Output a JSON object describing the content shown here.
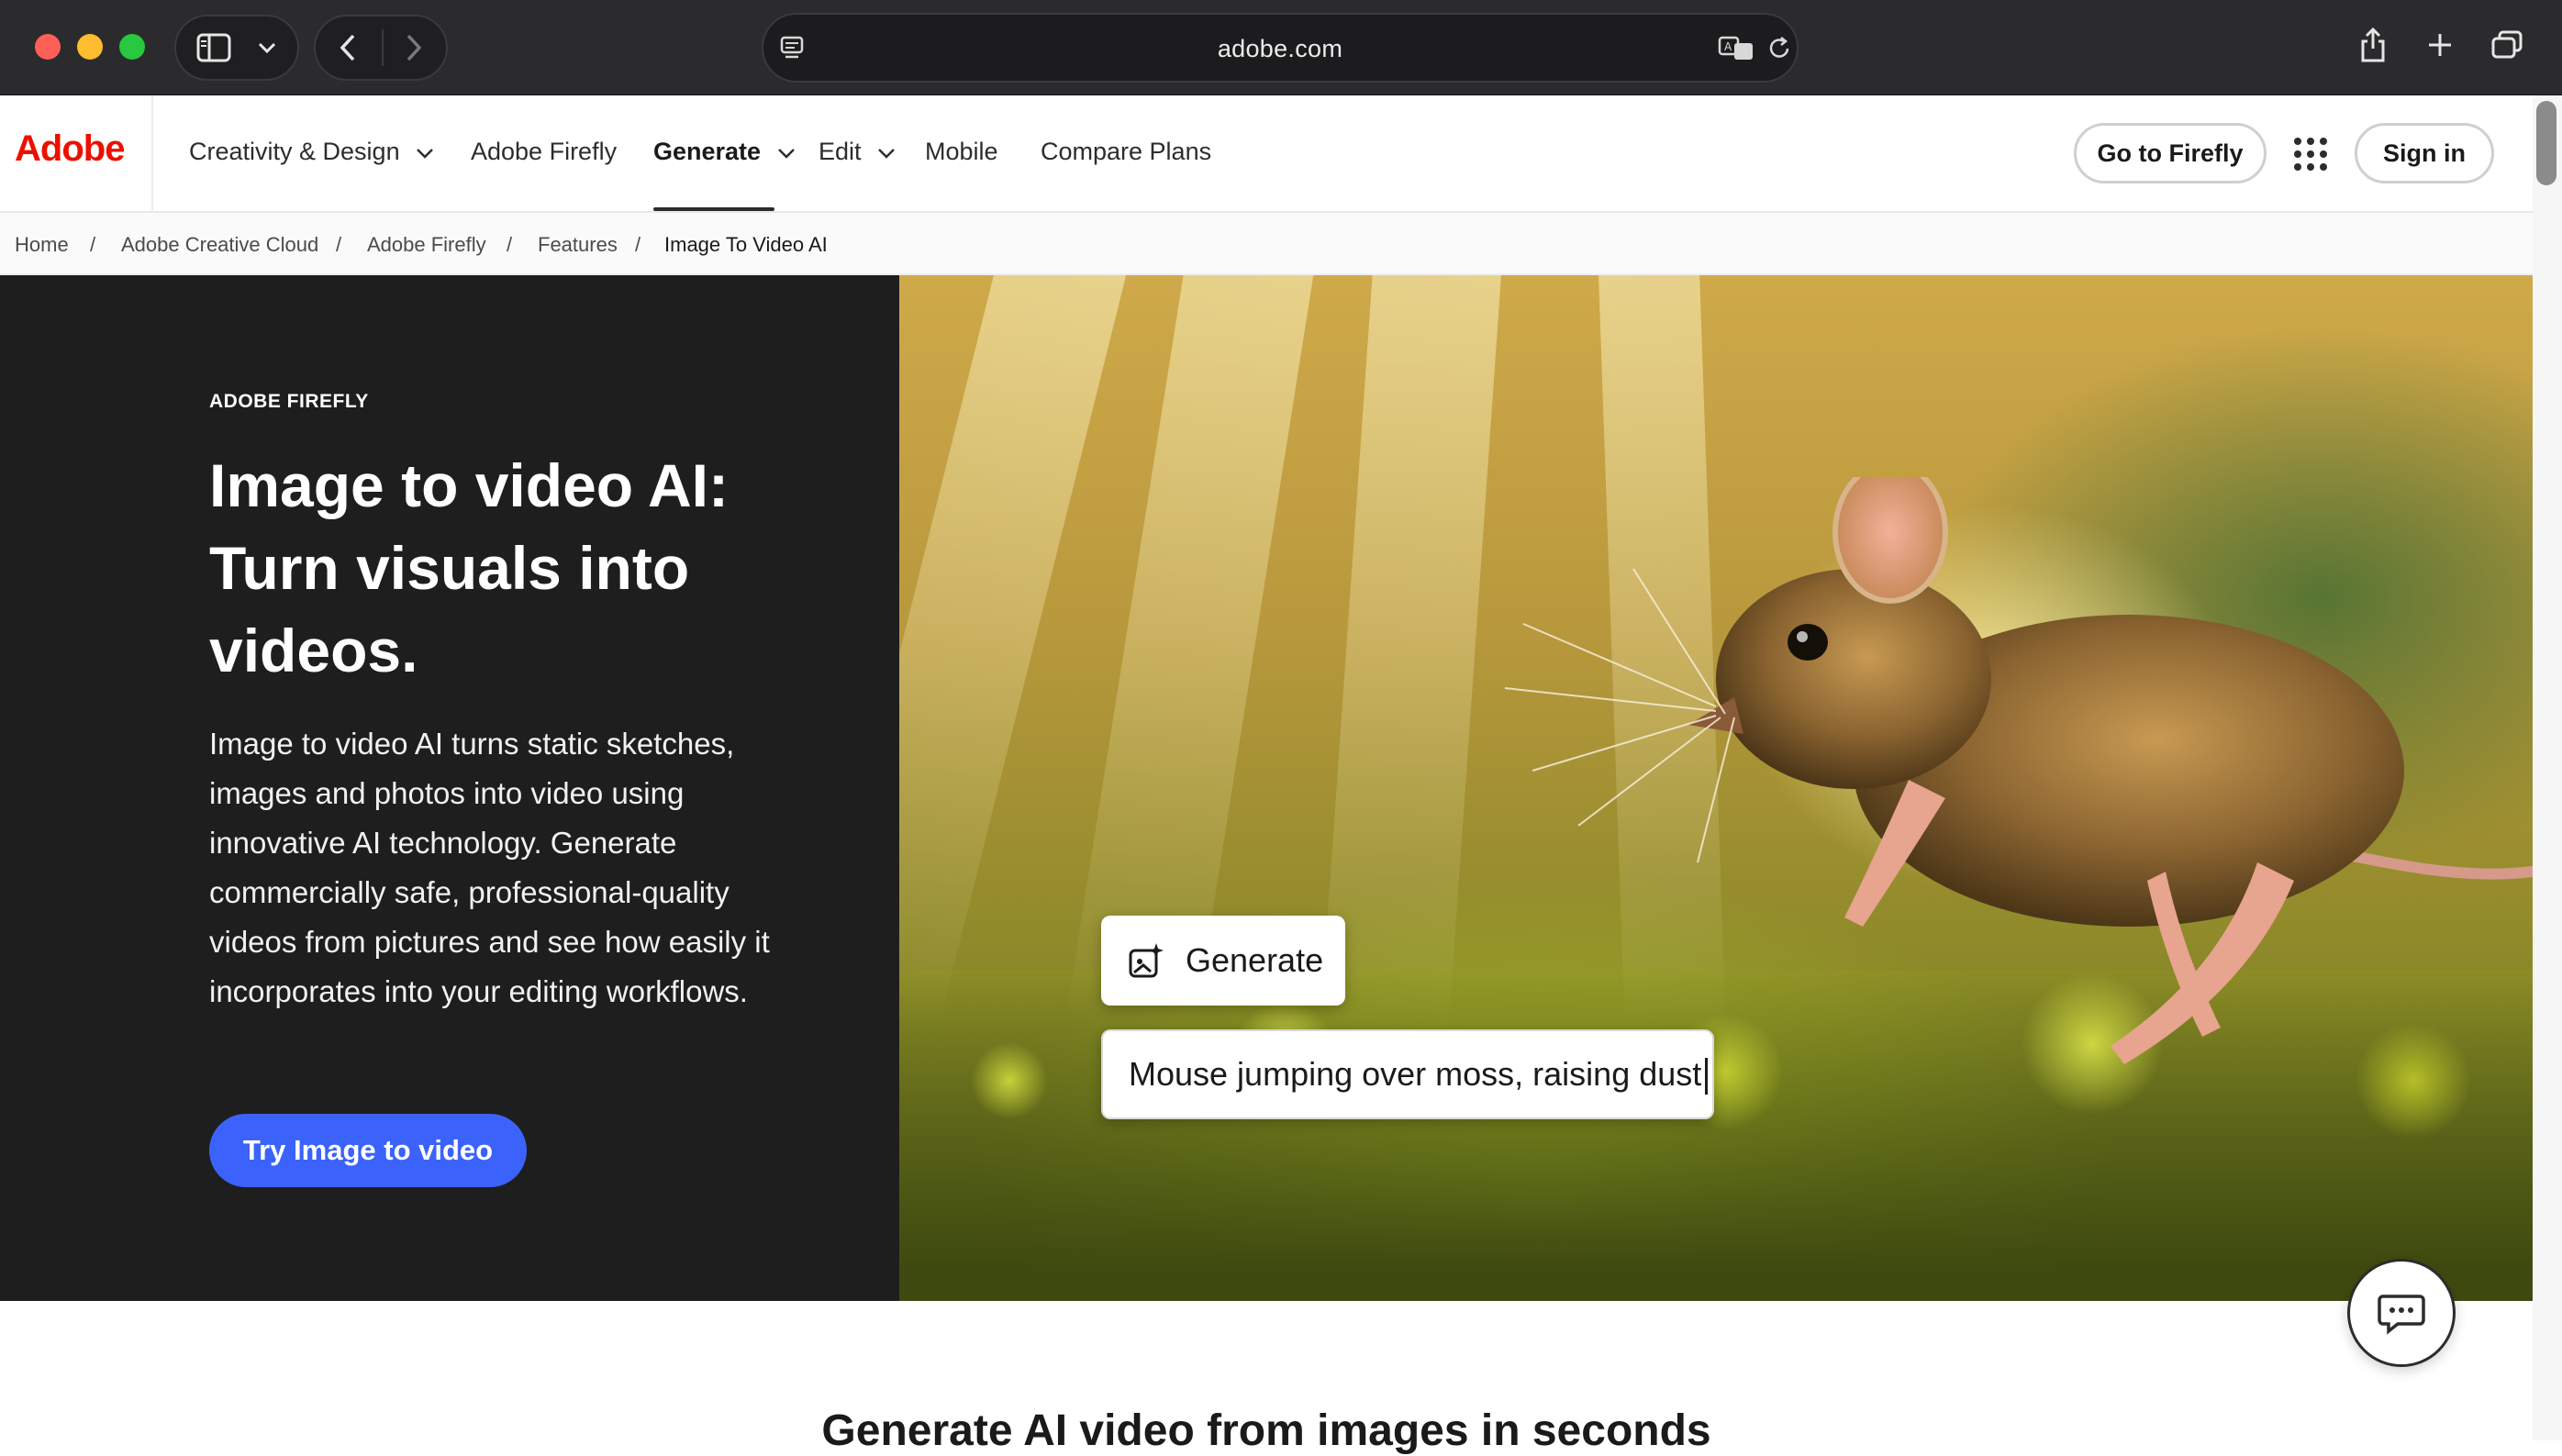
{
  "browser": {
    "url": "adobe.com"
  },
  "nav": {
    "logo": "Adobe",
    "items": [
      {
        "label": "Creativity & Design"
      },
      {
        "label": "Adobe Firefly"
      },
      {
        "label": "Generate"
      },
      {
        "label": "Edit"
      },
      {
        "label": "Mobile"
      },
      {
        "label": "Compare Plans"
      }
    ],
    "go_to_firefly": "Go to Firefly",
    "sign_in": "Sign in"
  },
  "breadcrumb": [
    "Home",
    "Adobe Creative Cloud",
    "Adobe Firefly",
    "Features",
    "Image To Video AI"
  ],
  "hero": {
    "eyebrow": "ADOBE FIREFLY",
    "title": "Image to video AI: Turn visuals into videos.",
    "description": "Image to video AI turns static sketches, images and photos into video using innovative AI technology. Generate commercially safe, professional-quality videos from pictures and see how easily it incorporates into your editing workflows.",
    "cta": "Try Image to video",
    "generate_label": "Generate",
    "prompt": "Mouse jumping over moss, raising dust"
  },
  "section": {
    "title": "Generate AI video from images in seconds"
  },
  "colors": {
    "adobe_red": "#eb1000",
    "cta_blue": "#3b63fb",
    "hero_dark": "#1e1e1e"
  },
  "icons": {
    "sidebar": "sidebar-icon",
    "back": "chevron-left-icon",
    "forward": "chevron-right-icon",
    "share": "share-icon",
    "new_tab": "plus-icon",
    "tabs": "tabs-overview-icon",
    "translate": "translate-icon",
    "reload": "reload-icon",
    "apps": "app-grid-icon",
    "chat": "chat-icon",
    "generate": "sparkle-image-icon"
  }
}
